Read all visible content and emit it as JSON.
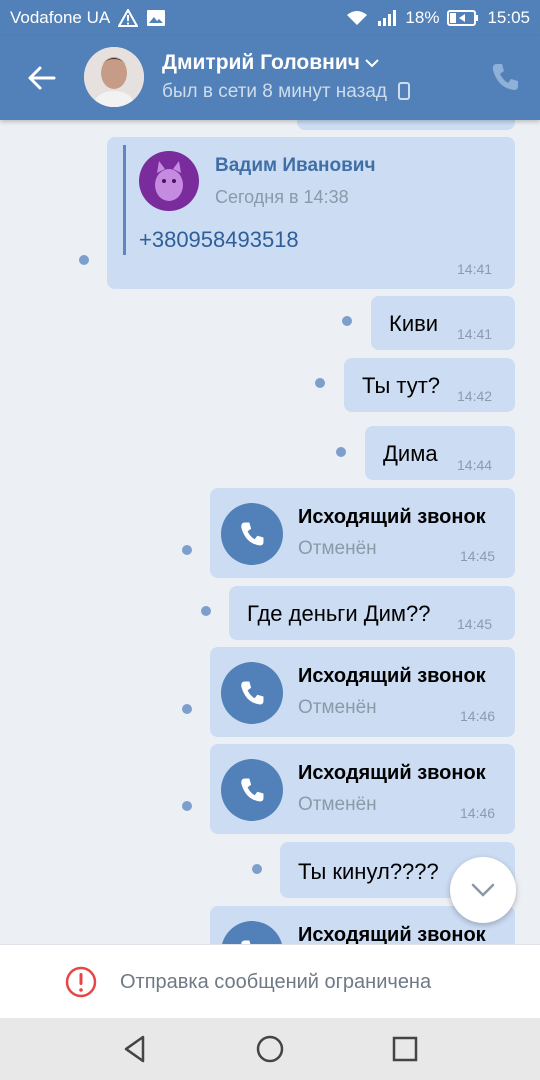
{
  "status_bar": {
    "carrier": "Vodafone UA",
    "battery": "18%",
    "time": "15:05"
  },
  "header": {
    "name": "Дмитрий Головнич",
    "status": "был в сети 8 минут назад"
  },
  "messages": {
    "forwarded": {
      "author": "Вадим Иванович",
      "date": "Сегодня в 14:38",
      "text": "+380958493518",
      "time": "14:41"
    },
    "m1": {
      "text": "Киви",
      "time": "14:41"
    },
    "m2": {
      "text": "Ты тут?",
      "time": "14:42"
    },
    "m3": {
      "text": "Дима",
      "time": "14:44"
    },
    "call1": {
      "title": "Исходящий звонок",
      "status": "Отменён",
      "time": "14:45"
    },
    "m4": {
      "text": "Где деньги Дим??",
      "time": "14:45"
    },
    "call2": {
      "title": "Исходящий звонок",
      "status": "Отменён",
      "time": "14:46"
    },
    "call3": {
      "title": "Исходящий звонок",
      "status": "Отменён",
      "time": "14:46"
    },
    "m5": {
      "text": "Ты кинул????"
    },
    "call4": {
      "title": "Исходящий звонок"
    }
  },
  "restriction": {
    "text": "Отправка сообщений ограничена"
  },
  "colors": {
    "accent": "#5181b8",
    "bubble": "#cbdcf3",
    "background": "#eceff3"
  },
  "icons": [
    "back-arrow-icon",
    "chevron-down-icon",
    "phone-icon",
    "mobile-icon",
    "call-icon",
    "chevron-down-icon",
    "warning-circle-icon",
    "nav-back-icon",
    "nav-home-icon",
    "nav-recent-icon"
  ]
}
